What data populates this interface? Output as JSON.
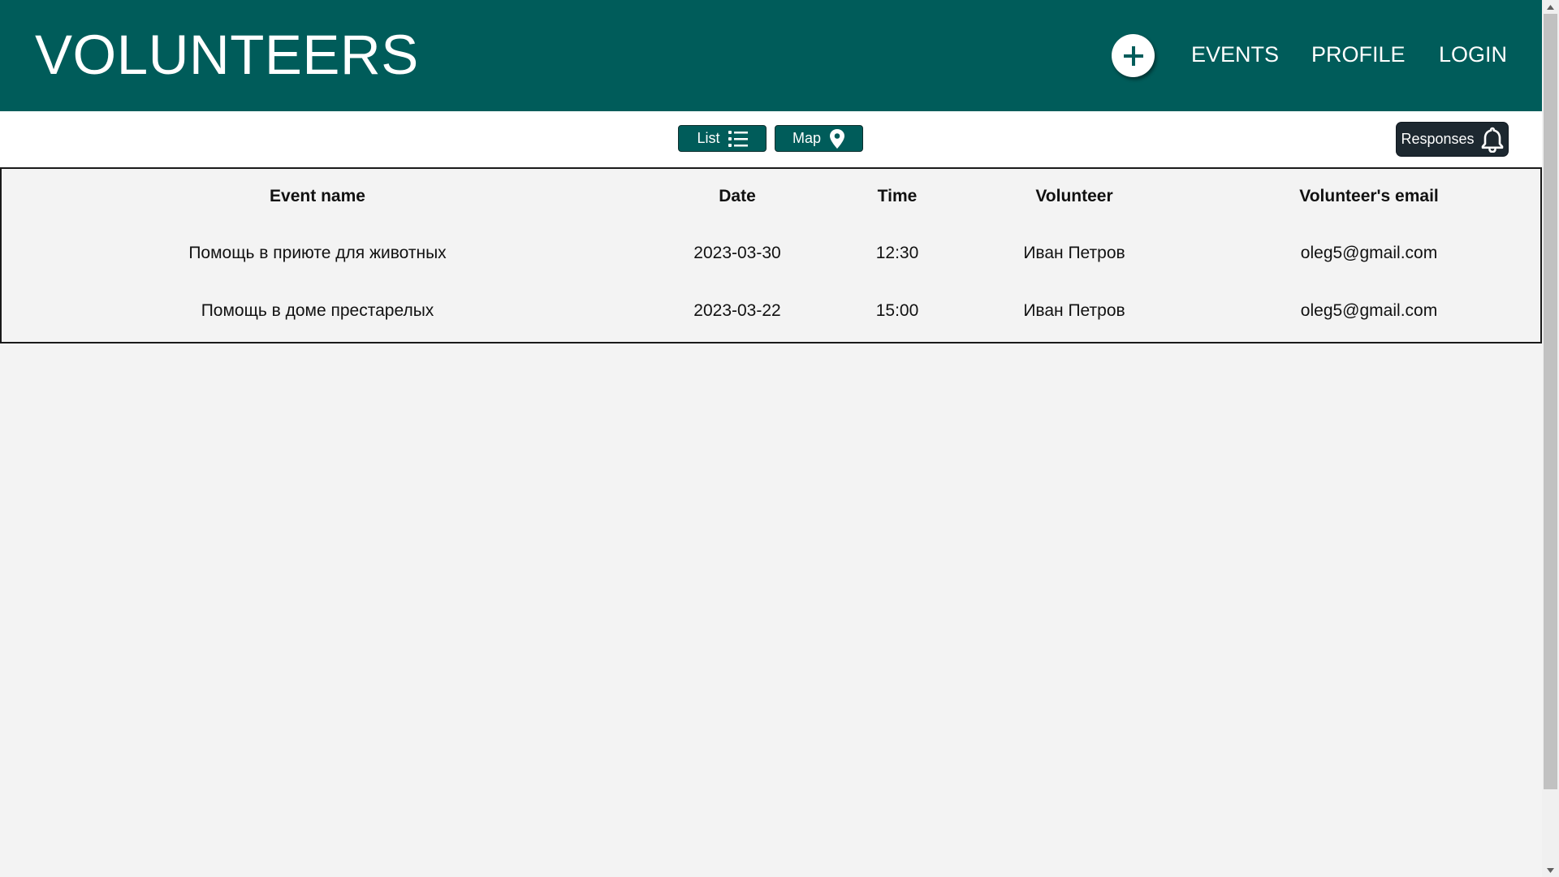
{
  "header": {
    "brand": "VOLUNTEERS",
    "add_icon": "plus-circle-icon",
    "nav": [
      "EVENTS",
      "PROFILE",
      "LOGIN"
    ]
  },
  "toolbar": {
    "list_label": "List",
    "list_icon": "list-icon",
    "map_label": "Map",
    "map_icon": "map-pin-icon",
    "responses_label": "Responses",
    "responses_icon": "bell-icon"
  },
  "table": {
    "columns": [
      "Event name",
      "Date",
      "Time",
      "Volunteer",
      "Volunteer's email"
    ],
    "rows": [
      [
        "Помощь в приюте для животных",
        "2023-03-30",
        "12:30",
        "Иван Петров",
        "oleg5@gmail.com"
      ],
      [
        "Помощь в доме престарелых",
        "2023-03-22",
        "15:00",
        "Иван Петров",
        "oleg5@gmail.com"
      ]
    ]
  },
  "colors": {
    "brand": "#005c5a",
    "responses_bg": "#1d2830",
    "page_bg": "#f3f3f3"
  }
}
